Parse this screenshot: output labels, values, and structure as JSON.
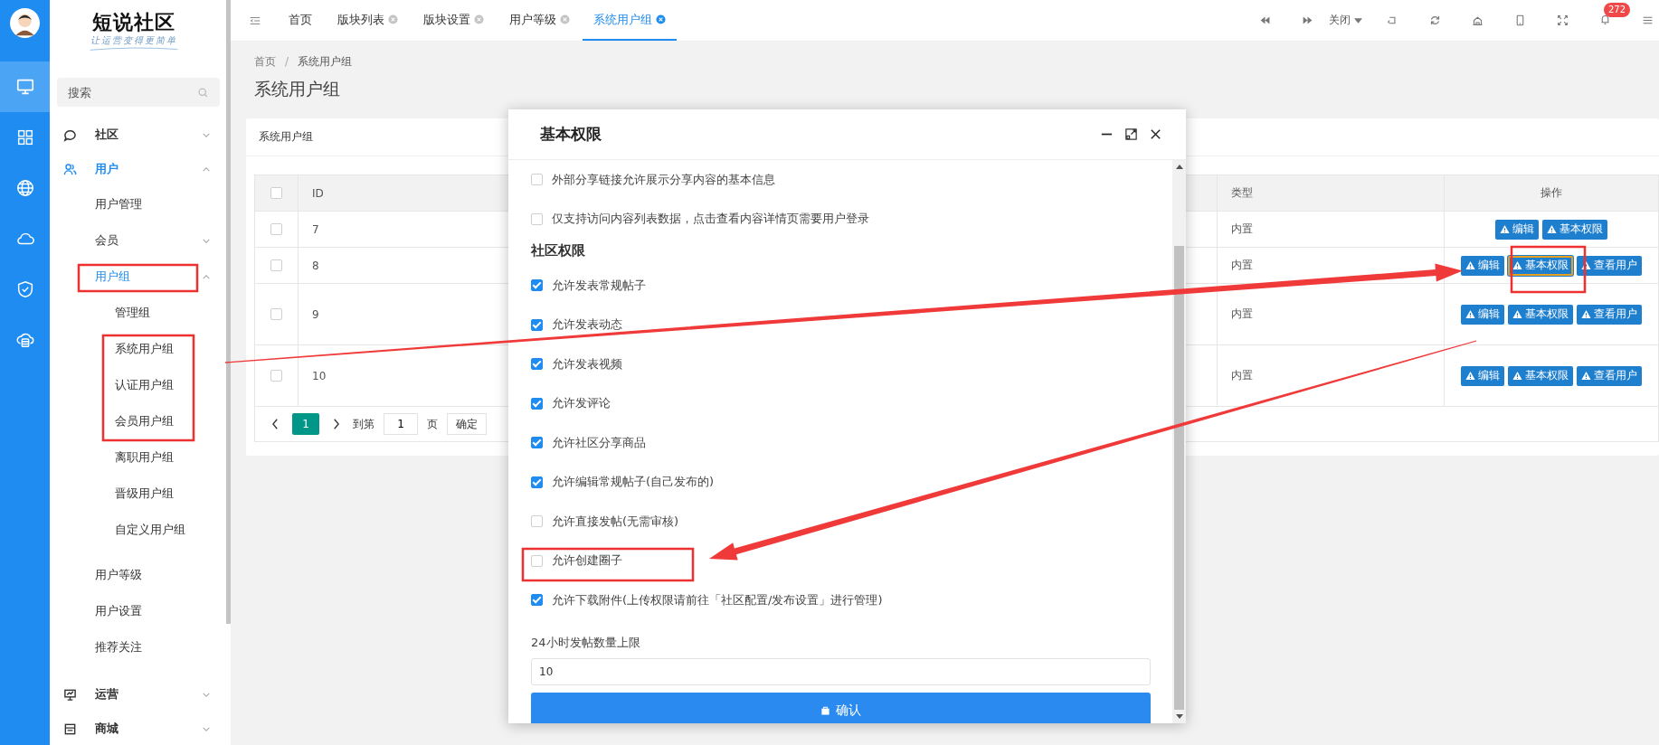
{
  "rail": {
    "items": [
      {
        "kind": "monitor",
        "selected": true
      },
      {
        "kind": "grid",
        "selected": false
      },
      {
        "kind": "globe",
        "selected": false
      },
      {
        "kind": "cloud",
        "selected": false
      },
      {
        "kind": "shield",
        "selected": false
      },
      {
        "kind": "cloud-db",
        "selected": false
      }
    ]
  },
  "brand": {
    "name": "短说社区",
    "slogan": "让运营变得更简单"
  },
  "search": {
    "placeholder": "搜索"
  },
  "menu": [
    {
      "label": "社区",
      "kind": "chat",
      "expanded": false,
      "active": false
    },
    {
      "label": "用户",
      "kind": "users",
      "expanded": true,
      "active": true,
      "children": [
        {
          "label": "用户管理",
          "active": false
        },
        {
          "label": "会员",
          "expanded": false,
          "active": false
        },
        {
          "label": "用户组",
          "expanded": true,
          "active": true,
          "children": [
            {
              "label": "管理组",
              "active": false
            },
            {
              "label": "系统用户组",
              "active": false
            },
            {
              "label": "认证用户组",
              "active": false
            },
            {
              "label": "会员用户组",
              "active": false
            },
            {
              "label": "离职用户组",
              "active": false
            },
            {
              "label": "晋级用户组",
              "active": false
            },
            {
              "label": "自定义用户组",
              "active": false
            }
          ]
        },
        {
          "label": "用户等级",
          "active": false
        },
        {
          "label": "用户设置",
          "active": false
        },
        {
          "label": "推荐关注",
          "active": false
        }
      ]
    },
    {
      "label": "运营",
      "kind": "presentation",
      "expanded": false,
      "active": false
    },
    {
      "label": "商城",
      "kind": "shop",
      "expanded": false,
      "active": false
    }
  ],
  "tabs": [
    {
      "label": "首页",
      "closable": false,
      "selected": false
    },
    {
      "label": "版块列表",
      "closable": true,
      "selected": false
    },
    {
      "label": "版块设置",
      "closable": true,
      "selected": false
    },
    {
      "label": "用户等级",
      "closable": true,
      "selected": false
    },
    {
      "label": "系统用户组",
      "closable": true,
      "selected": true
    }
  ],
  "topbar": {
    "close_menu": "关闭",
    "notification_count": "272"
  },
  "breadcrumb": [
    "首页",
    "系统用户组"
  ],
  "breadcrumb_separator": "/",
  "page_title": "系统用户组",
  "card": {
    "title": "系统用户组",
    "table": {
      "header_checked": false,
      "columns": [
        {
          "label": "ID"
        },
        {
          "label": "类型"
        },
        {
          "label": "操作"
        }
      ],
      "rows": [
        {
          "id": "7",
          "checked": false,
          "type": "内置",
          "actions": [
            {
              "label": "编辑",
              "focused": false
            },
            {
              "label": "基本权限",
              "focused": false
            }
          ]
        },
        {
          "id": "8",
          "checked": false,
          "type": "内置",
          "actions": [
            {
              "label": "编辑",
              "focused": false
            },
            {
              "label": "基本权限",
              "focused": true
            },
            {
              "label": "查看用户",
              "focused": false
            }
          ]
        },
        {
          "id": "9",
          "checked": false,
          "type": "内置",
          "actions": [
            {
              "label": "编辑",
              "focused": false
            },
            {
              "label": "基本权限",
              "focused": false
            },
            {
              "label": "查看用户",
              "focused": false
            }
          ]
        },
        {
          "id": "10",
          "checked": false,
          "type": "内置",
          "actions": [
            {
              "label": "编辑",
              "focused": false
            },
            {
              "label": "基本权限",
              "focused": false
            },
            {
              "label": "查看用户",
              "focused": false
            }
          ]
        }
      ]
    },
    "pagination": {
      "pages": [
        {
          "label": "1",
          "selected": true
        }
      ],
      "goto_label": "到第",
      "page_input": "1",
      "page_unit": "页",
      "confirm": "确定"
    }
  },
  "modal": {
    "title": "基本权限",
    "items": [
      {
        "kind": "checkbox",
        "label": "外部分享链接允许展示分享内容的基本信息",
        "checked": false
      },
      {
        "kind": "checkbox",
        "label": "仅支持访问内容列表数据，点击查看内容详情页需要用户登录",
        "checked": false
      },
      {
        "kind": "heading",
        "label": "社区权限"
      },
      {
        "kind": "checkbox",
        "label": "允许发表常规帖子",
        "checked": true
      },
      {
        "kind": "checkbox",
        "label": "允许发表动态",
        "checked": true
      },
      {
        "kind": "checkbox",
        "label": "允许发表视频",
        "checked": true
      },
      {
        "kind": "checkbox",
        "label": "允许发评论",
        "checked": true
      },
      {
        "kind": "checkbox",
        "label": "允许社区分享商品",
        "checked": true
      },
      {
        "kind": "checkbox",
        "label": "允许编辑常规帖子(自己发布的)",
        "checked": true
      },
      {
        "kind": "checkbox",
        "label": "允许直接发帖(无需审核)",
        "checked": false
      },
      {
        "kind": "checkbox",
        "label": "允许创建圈子",
        "checked": false
      },
      {
        "kind": "checkbox",
        "label": "允许下载附件(上传权限请前往「社区配置/发布设置」进行管理)",
        "checked": true
      },
      {
        "kind": "field",
        "label": "24小时发帖数量上限",
        "value": "10"
      },
      {
        "kind": "submit",
        "label": "确认"
      }
    ]
  }
}
